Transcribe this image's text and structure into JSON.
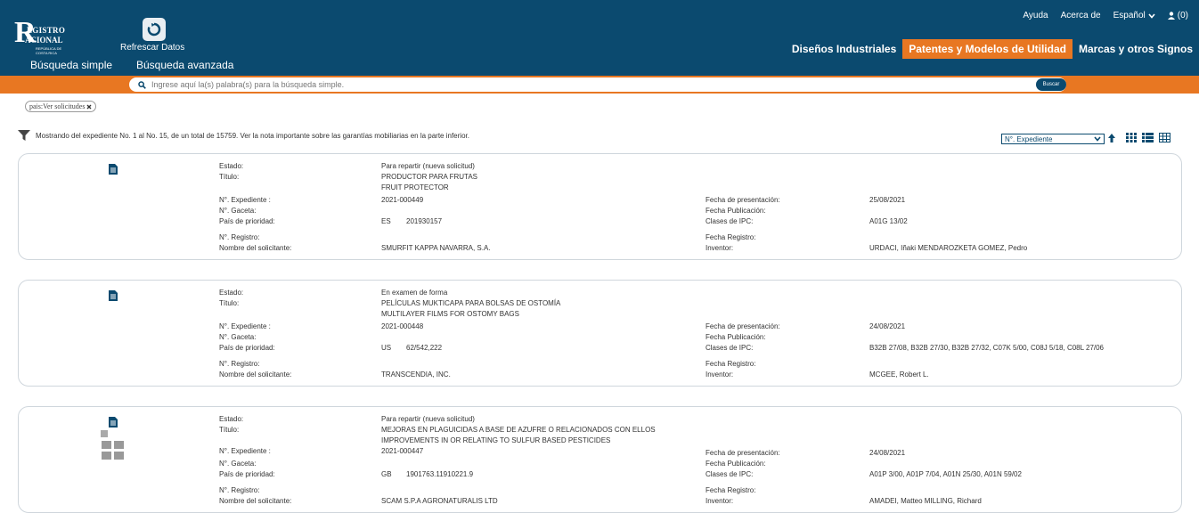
{
  "header": {
    "logo": {
      "line1": "R",
      "line2": "EGISTRO",
      "line3": "ACIONAL",
      "line4": "REPÚBLICA DE COSTA RICA"
    },
    "refresh_label": "Refrescar Datos",
    "nav": {
      "simple": "Búsqueda simple",
      "advanced": "Búsqueda avanzada"
    },
    "top_links": {
      "help": "Ayuda",
      "about": "Acerca de",
      "language": "Español",
      "user": "(0)"
    },
    "sections": [
      "Diseños Industriales",
      "Patentes y Modelos de Utilidad",
      "Marcas y otros Signos"
    ],
    "active_section": "Patentes y Modelos de Utilidad"
  },
  "search": {
    "placeholder": "Ingrese aquí la(s) palabra(s) para la búsqueda simple.",
    "button": "Buscar"
  },
  "filter_chip": "pais:Ver solicitudes",
  "result_info": "Mostrando del expediente No. 1 al No. 15, de un total de 15759. Ver la nota importante sobre las garantías mobiliarias en la parte inferior.",
  "sort": {
    "selected": "N°. Expediente"
  },
  "labels": {
    "estado": "Estado:",
    "titulo": "Título:",
    "expediente": "N°. Expediente :",
    "gaceta": "N°. Gaceta:",
    "pais": "País de prioridad:",
    "registro": "N°. Registro:",
    "solicitante": "Nombre del solicitante:",
    "fecha_presentacion": "Fecha de presentación:",
    "fecha_publicacion": "Fecha Publicación:",
    "clases": "Clases de IPC:",
    "fecha_registro": "Fecha Registro:",
    "inventor": "Inventor:"
  },
  "results": [
    {
      "estado": "Para repartir (nueva solicitud)",
      "titulo_es": "PRODUCTOR PARA FRUTAS",
      "titulo_en": "FRUIT PROTECTOR",
      "expediente": "2021-000449",
      "gaceta": "",
      "pais": "ES",
      "prioridad": "201930157",
      "registro": "",
      "solicitante": "SMURFIT KAPPA NAVARRA, S.A.",
      "fecha_presentacion": "25/08/2021",
      "fecha_publicacion": "",
      "clases": "A01G 13/02",
      "fecha_registro": "",
      "inventor": "URDACI, Iñaki MENDAROZKETA GOMEZ, Pedro"
    },
    {
      "estado": "En examen de forma",
      "titulo_es": "PELÍCULAS MUKTICAPA PARA BOLSAS DE OSTOMÍA",
      "titulo_en": "MULTILAYER FILMS FOR OSTOMY BAGS",
      "expediente": "2021-000448",
      "gaceta": "",
      "pais": "US",
      "prioridad": "62/542,222",
      "registro": "",
      "solicitante": "TRANSCENDIA, INC.",
      "fecha_presentacion": "24/08/2021",
      "fecha_publicacion": "",
      "clases": "B32B 27/08, B32B 27/30, B32B 27/32, C07K 5/00, C08J 5/18, C08L 27/06",
      "fecha_registro": "",
      "inventor": "MCGEE, Robert L."
    },
    {
      "estado": "Para repartir (nueva solicitud)",
      "titulo_es": "MEJORAS EN PLAGUICIDAS A BASE DE AZUFRE O RELACIONADOS CON ELLOS",
      "titulo_en": "IMPROVEMENTS IN OR RELATING TO SULFUR BASED PESTICIDES",
      "expediente": "2021-000447",
      "gaceta": "",
      "pais": "GB",
      "prioridad": "1901763.11910221.9",
      "registro": "",
      "solicitante": "SCAM S.P.A AGRONATURALIS LTD",
      "fecha_presentacion": "24/08/2021",
      "fecha_publicacion": "",
      "clases": "A01P 3/00, A01P 7/04, A01N 25/30, A01N 59/02",
      "fecha_registro": "",
      "inventor": "AMADEI, Matteo MILLING, Richard"
    }
  ],
  "colors": {
    "navy": "#0b4a6f",
    "orange": "#e87722"
  }
}
